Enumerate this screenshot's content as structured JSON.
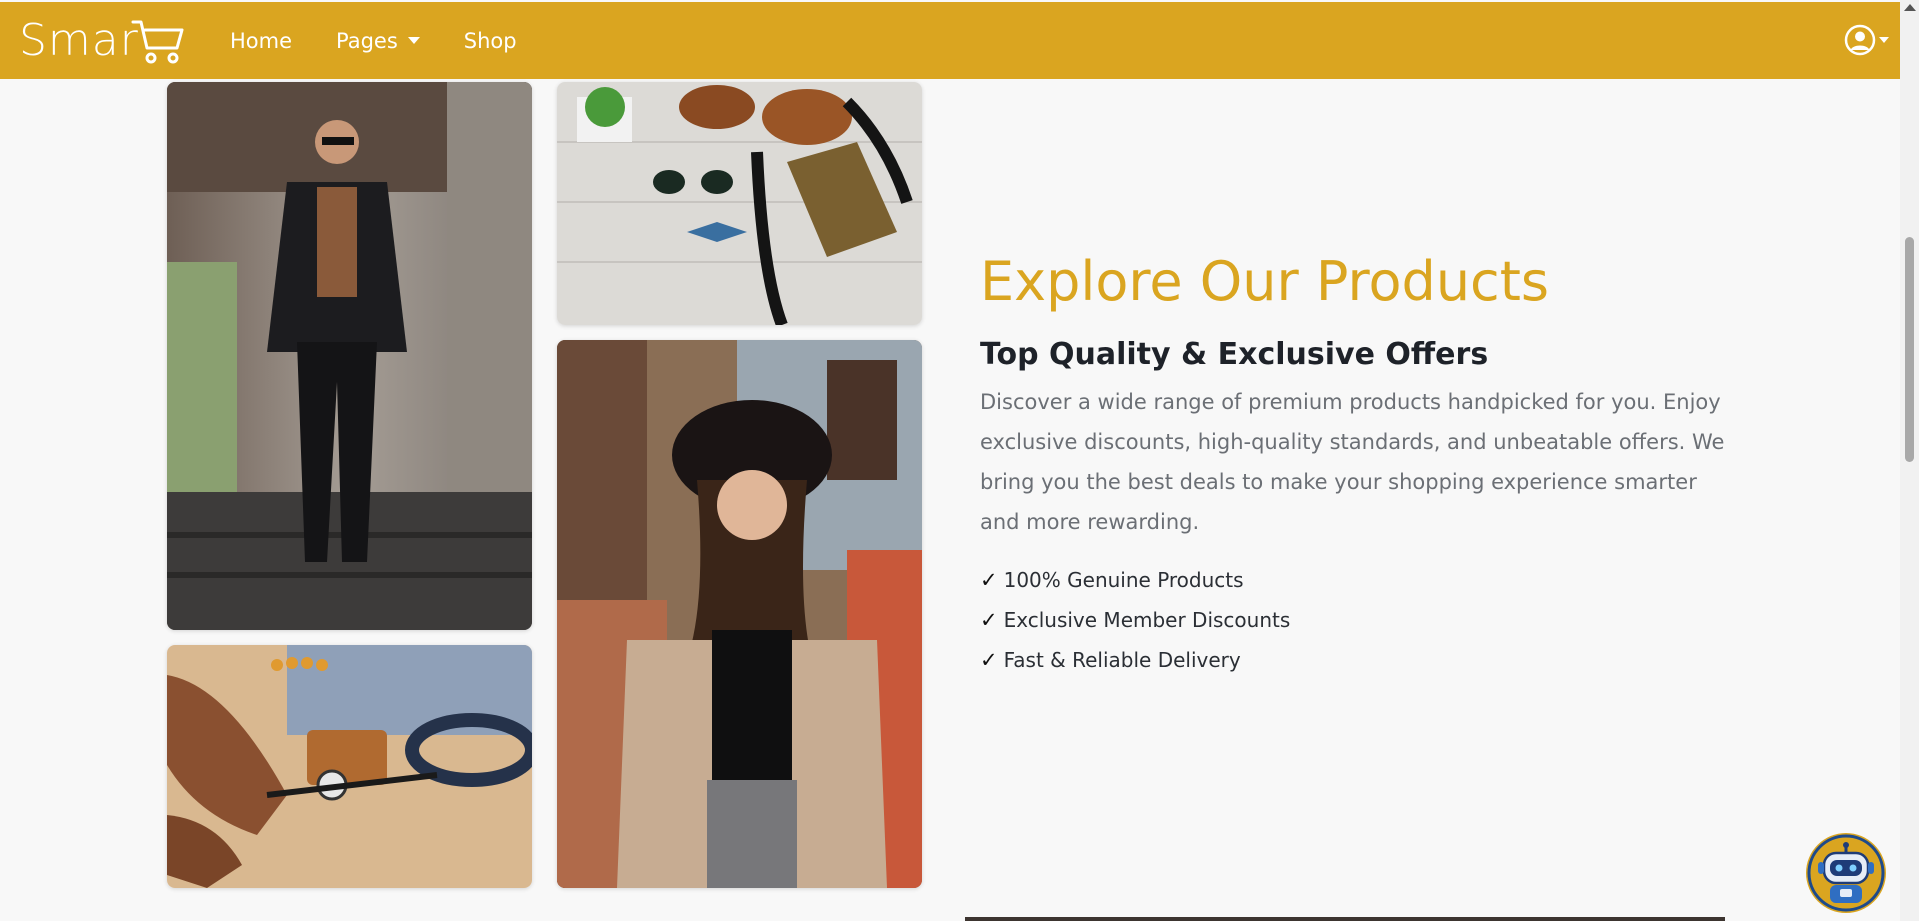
{
  "navbar": {
    "logo_text": "Smar",
    "links": [
      {
        "label": "Home"
      },
      {
        "label": "Pages"
      },
      {
        "label": "Shop"
      }
    ]
  },
  "hero": {
    "heading": "Explore Our Products",
    "subheading": "Top Quality & Exclusive Offers",
    "description": "Discover a wide range of premium products handpicked for you. Enjoy exclusive discounts, high-quality standards, and unbeatable offers. We bring you the best deals to make your shopping experience smarter and more rewarding.",
    "check_symbol": "✓",
    "features": [
      "100% Genuine Products",
      "Exclusive Member Discounts",
      "Fast & Reliable Delivery"
    ]
  },
  "colors": {
    "brand": "#daa520",
    "heading_text": "#1e2229",
    "body_text": "#6b6f75"
  },
  "icons": {
    "logo": "shopping-cart-icon",
    "user": "user-circle-icon",
    "chatbot": "robot-icon"
  }
}
